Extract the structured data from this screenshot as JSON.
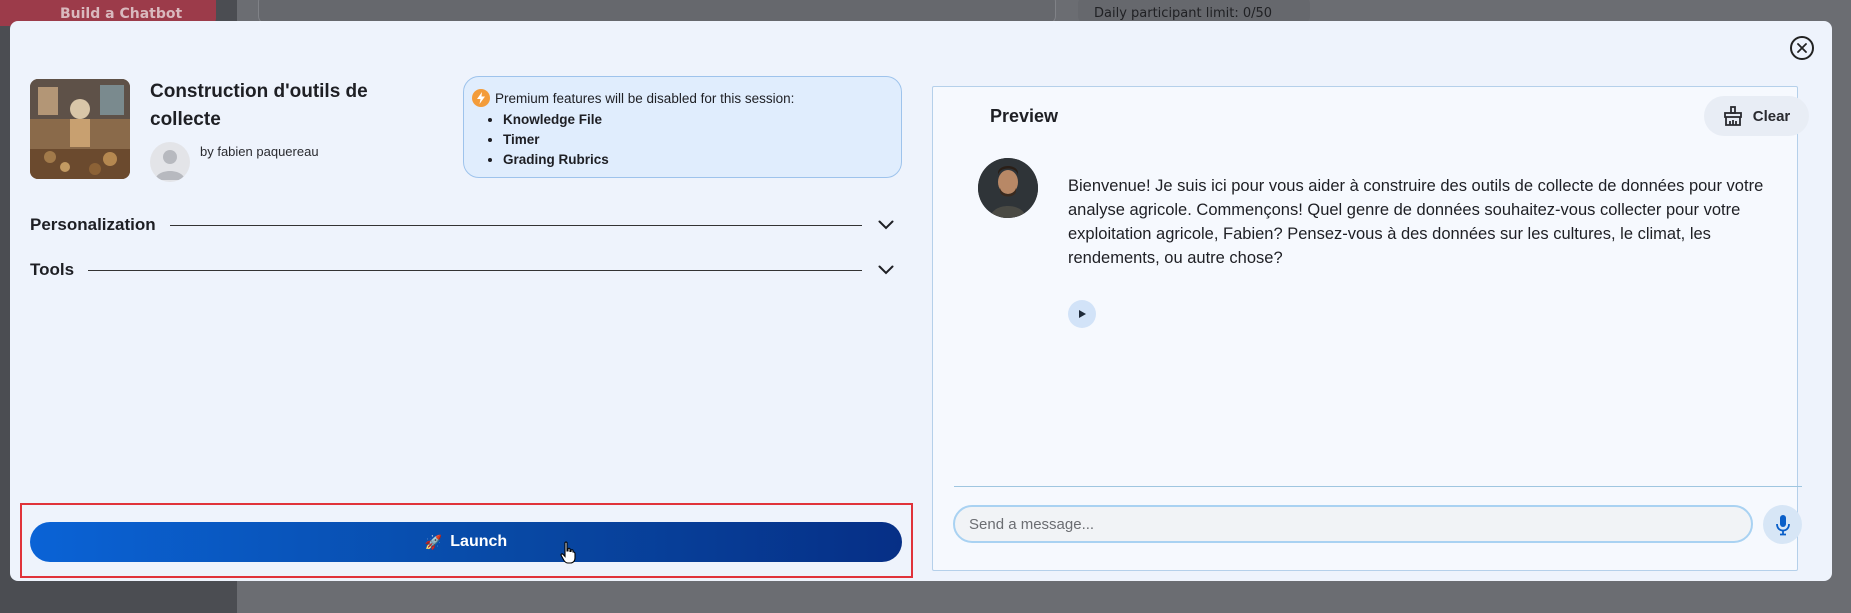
{
  "background": {
    "build_label": "Build a Chatbot",
    "limit_label": "Daily participant limit: 0/50"
  },
  "modal": {
    "close_icon": "close-icon",
    "bot": {
      "title": "Construction d'outils de collecte",
      "author": "by fabien paquereau"
    },
    "premium": {
      "heading": "Premium features will be disabled for this session:",
      "icon": "bolt-icon",
      "items": [
        "Knowledge File",
        "Timer",
        "Grading Rubrics"
      ]
    },
    "sections": [
      {
        "label": "Personalization"
      },
      {
        "label": "Tools"
      }
    ],
    "launch": {
      "label": "Launch",
      "icon": "rocket-icon"
    }
  },
  "preview": {
    "title": "Preview",
    "clear_label": "Clear",
    "message": "Bienvenue! Je suis ici pour vous aider à construire des outils de collecte de données pour votre analyse agricole. Commençons! Quel genre de données souhaitez-vous collecter pour votre exploitation agricole, Fabien? Pensez-vous à des données sur les cultures, le climat, les rendements, ou autre chose?",
    "input_placeholder": "Send a message...",
    "mic_icon": "microphone-icon"
  },
  "colors": {
    "accent": "#0849a5",
    "modal_bg": "#eef3fc",
    "highlight_border": "#e0323a",
    "premium_bg": "#e0edfd"
  }
}
